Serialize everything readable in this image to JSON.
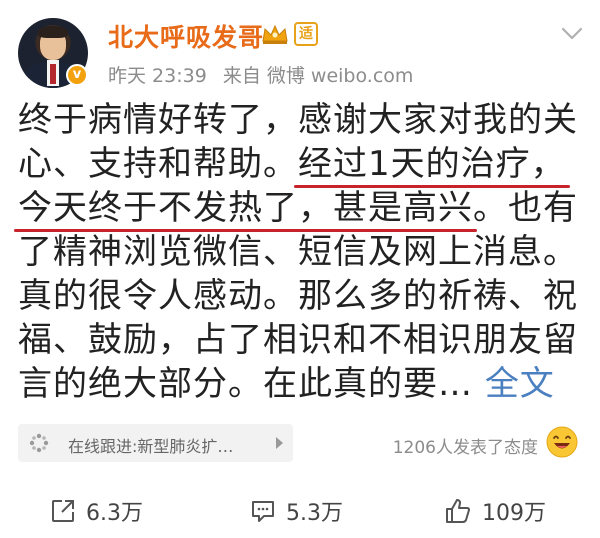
{
  "post": {
    "username": "北大呼吸发哥",
    "badge_text": "适",
    "verify_text": "v",
    "time": "昨天 23:39",
    "source": "来自 微博 weibo.com",
    "content_lines": [
      {
        "pre": "终于病情好转了，感谢大家对我的关",
        "hl": "",
        "post": ""
      },
      {
        "pre": "心、支持和帮助。",
        "hl": "经过1天的治疗，",
        "post": ""
      },
      {
        "pre": "",
        "hl": "今天终于不发热了，甚是高兴",
        "post": "。也有"
      },
      {
        "pre": "了精神浏览微信、短信及网上消息。",
        "hl": "",
        "post": ""
      },
      {
        "pre": "真的很令人感动。那么多的祈祷、祝",
        "hl": "",
        "post": ""
      },
      {
        "pre": "福、鼓励，占了相识和不相识朋友留",
        "hl": "",
        "post": ""
      },
      {
        "pre": "言的绝大部分。在此真的要… ",
        "hl": "",
        "post": ""
      }
    ],
    "fulltext_label": "全文"
  },
  "topic": {
    "label": "在线跟进:新型肺炎扩…"
  },
  "reactions": {
    "label": "1206人发表了态度"
  },
  "actions": {
    "share_count": "6.3万",
    "comment_count": "5.3万",
    "like_count": "109万"
  },
  "colors": {
    "username": "#e86b1a",
    "link": "#4a7fc0",
    "highlight_underline": "#c8232b",
    "meta": "#8c8c8c"
  }
}
